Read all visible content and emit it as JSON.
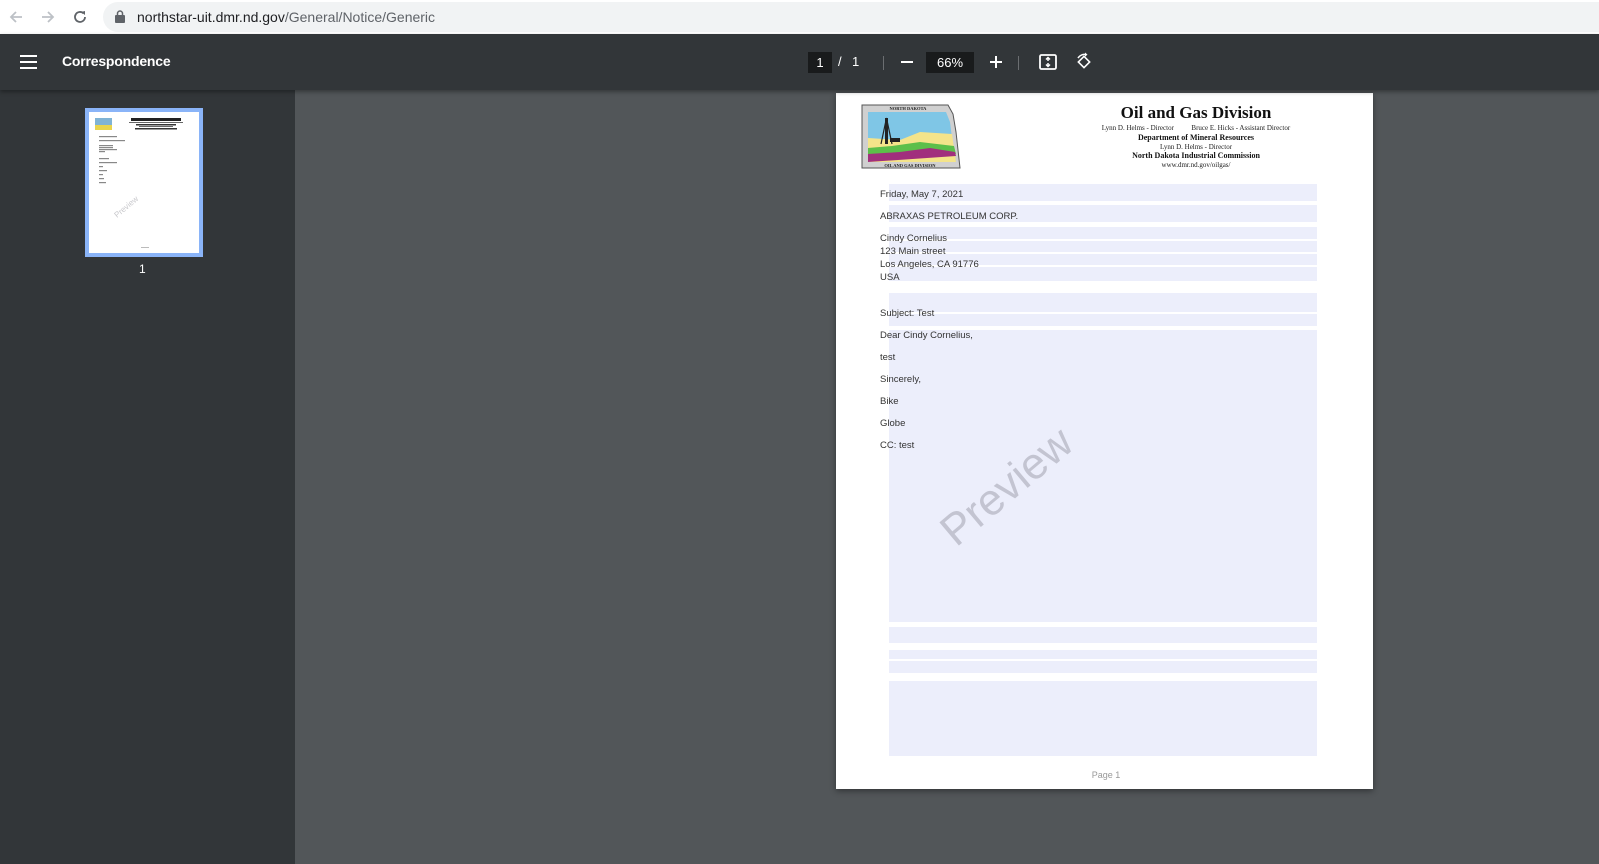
{
  "browser": {
    "url_host": "northstar-uit.dmr.nd.gov",
    "url_path": "/General/Notice/Generic",
    "back_icon": "arrow-left-icon",
    "forward_icon": "arrow-right-icon",
    "reload_icon": "reload-icon",
    "lock_icon": "lock-icon"
  },
  "toolbar": {
    "title": "Correspondence",
    "page_current": "1",
    "page_separator": "/",
    "page_total": "1",
    "zoom": "66%",
    "menu_icon": "hamburger-menu-icon",
    "zoom_out_icon": "minus-icon",
    "zoom_in_icon": "plus-icon",
    "fit_icon": "fit-to-page-icon",
    "rotate_icon": "rotate-icon"
  },
  "sidebar": {
    "thumbnails": [
      {
        "label": "1"
      }
    ]
  },
  "document": {
    "header": {
      "logo_top": "NORTH DAKOTA",
      "logo_bottom": "OIL AND GAS DIVISION",
      "title": "Oil and Gas Division",
      "directors": "Lynn D. Helms - Director          Bruce E. Hicks - Assistant Director",
      "department": "Department of Mineral Resources",
      "dept_director": "Lynn D. Helms - Director",
      "commission": "North Dakota Industrial Commission",
      "website": "www.dmr.nd.gov/oilgas/"
    },
    "lines": {
      "date": "Friday, May 7, 2021",
      "company": "ABRAXAS PETROLEUM CORP.",
      "contact": "Cindy Cornelius",
      "street": "123 Main street",
      "city": "Los Angeles, CA 91776",
      "country": "USA",
      "subject": "Subject: Test",
      "salutation": "Dear Cindy Cornelius,",
      "body": "test",
      "closing": "Sincerely,",
      "sig1": "Bike",
      "sig2": "Globe",
      "cc": "CC: test"
    },
    "watermark": "Preview",
    "footer": "Page 1"
  }
}
